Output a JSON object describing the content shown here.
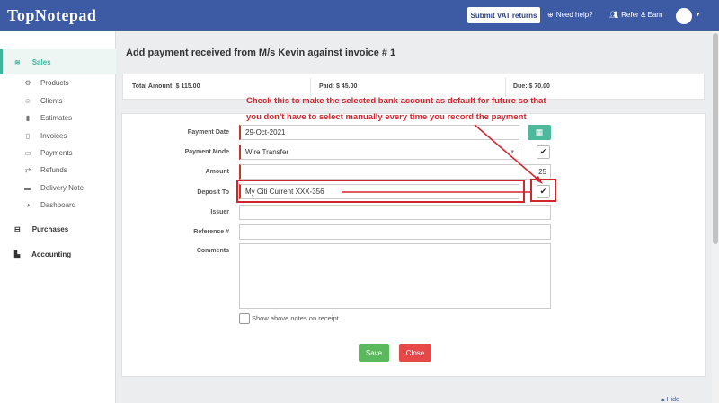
{
  "app": {
    "logo": "TopNotepad"
  },
  "header": {
    "vat_button": "Submit VAT returns",
    "help": "Need help?",
    "refer": "Refer & Earn"
  },
  "sidebar": {
    "sales": "Sales",
    "items": [
      "Products",
      "Clients",
      "Estimates",
      "Invoices",
      "Payments",
      "Refunds",
      "Delivery Note",
      "Dashboard"
    ],
    "purchases": "Purchases",
    "accounting": "Accounting"
  },
  "page": {
    "title": "Add payment received from M/s Kevin against invoice # 1"
  },
  "summary": {
    "total": "Total Amount: $ 115.00",
    "paid": "Paid: $ 45.00",
    "due": "Due: $ 70.00"
  },
  "annotation": {
    "line1": "Check this to make the selected bank account as default for future so that",
    "line2": "you don't have to select manually every time you record the payment"
  },
  "form": {
    "payment_date_label": "Payment Date",
    "payment_date_value": "29-Oct-2021",
    "payment_mode_label": "Payment Mode",
    "payment_mode_value": "Wire Transfer",
    "amount_label": "Amount",
    "amount_value": "25",
    "deposit_to_label": "Deposit To",
    "deposit_to_value": "My Citi Current XXX-356",
    "issuer_label": "Issuer",
    "reference_label": "Reference #",
    "comments_label": "Comments",
    "show_notes_label": "Show above notes on receipt.",
    "save_button": "Save",
    "close_button": "Close"
  },
  "footer": {
    "hide_link": "Hide"
  },
  "colors": {
    "topbar": "#3d5aa5",
    "accent": "#3fb59c",
    "annotation": "#d2262f"
  }
}
